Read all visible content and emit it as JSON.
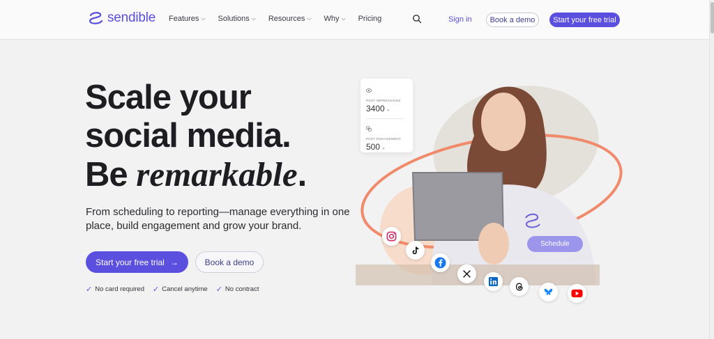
{
  "header": {
    "logo_text": "sendible",
    "nav": [
      {
        "label": "Features",
        "has_dropdown": true
      },
      {
        "label": "Solutions",
        "has_dropdown": true
      },
      {
        "label": "Resources",
        "has_dropdown": true
      },
      {
        "label": "Why",
        "has_dropdown": true
      },
      {
        "label": "Pricing",
        "has_dropdown": false
      }
    ],
    "sign_in": "Sign in",
    "book_demo": "Book a demo",
    "start_trial": "Start your free trial"
  },
  "hero": {
    "line1": "Scale your",
    "line2": "social media.",
    "line3_plain": "Be ",
    "line3_italic": "remarkable",
    "line3_end": ".",
    "subtitle": "From scheduling to reporting—manage everything in one place, build engagement and grow your brand.",
    "cta_primary": "Start your free trial",
    "cta_secondary": "Book a demo",
    "checks": [
      "No card required",
      "Cancel anytime",
      "No contract"
    ]
  },
  "stats": {
    "impressions_label": "POST IMPRESSIONS",
    "impressions_value": "3400",
    "engagement_label": "POST ENGAGEMENT",
    "engagement_value": "500",
    "unit_glyph": "»"
  },
  "schedule_label": "Schedule",
  "social_icons": [
    "instagram-icon",
    "tiktok-icon",
    "facebook-icon",
    "x-icon",
    "linkedin-icon",
    "threads-icon",
    "bluesky-icon",
    "youtube-icon"
  ],
  "colors": {
    "brand": "#5b4fe0",
    "accent_orange": "#f08a6a",
    "schedule": "#9b95ec"
  }
}
